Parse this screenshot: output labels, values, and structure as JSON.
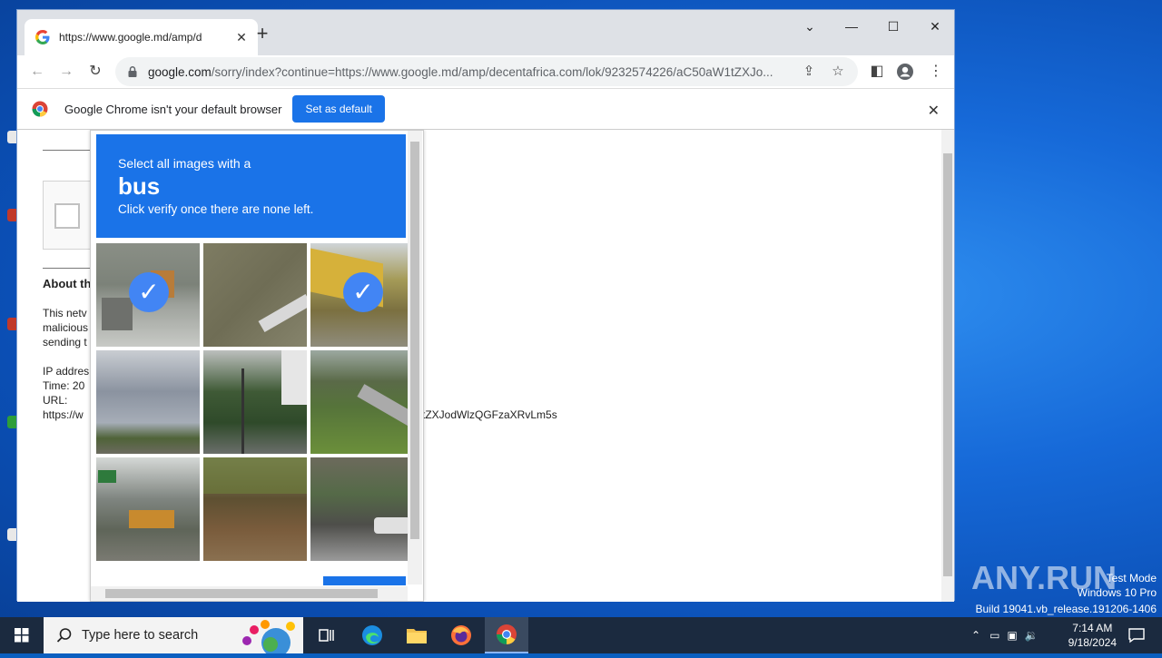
{
  "browser": {
    "tab_title": "https://www.google.md/amp/d",
    "url_domain": "google.com",
    "url_path": "/sorry/index?continue=https://www.google.md/amp/decentafrica.com/lok/9232574226/aC50aW1tZXJo...",
    "infobar_message": "Google Chrome isn't your default browser",
    "infobar_button": "Set as default"
  },
  "page": {
    "about_heading": "About th",
    "para1": [
      "This netv",
      "malicious",
      "sending t"
    ],
    "ip_label": "IP addres",
    "time_label": "Time: 20",
    "url_label": "URL:",
    "url_value": "https://w",
    "url_tail": "tZXJodWlzQGFzaXRvLm5s"
  },
  "captcha": {
    "line1": "Select all images with a",
    "target": "bus",
    "line3": "Click verify once there are none left."
  },
  "taskbar": {
    "search_placeholder": "Type here to search",
    "time": "7:14 AM",
    "date": "9/18/2024"
  },
  "watermark": {
    "brand": "ANY.RUN",
    "line1": "Test Mode",
    "line2": "Windows 10 Pro",
    "line3": "Build 19041.vb_release.191206-1406"
  },
  "colors": {
    "accent": "#1a73e8",
    "taskbar": "#1b2a3f"
  }
}
